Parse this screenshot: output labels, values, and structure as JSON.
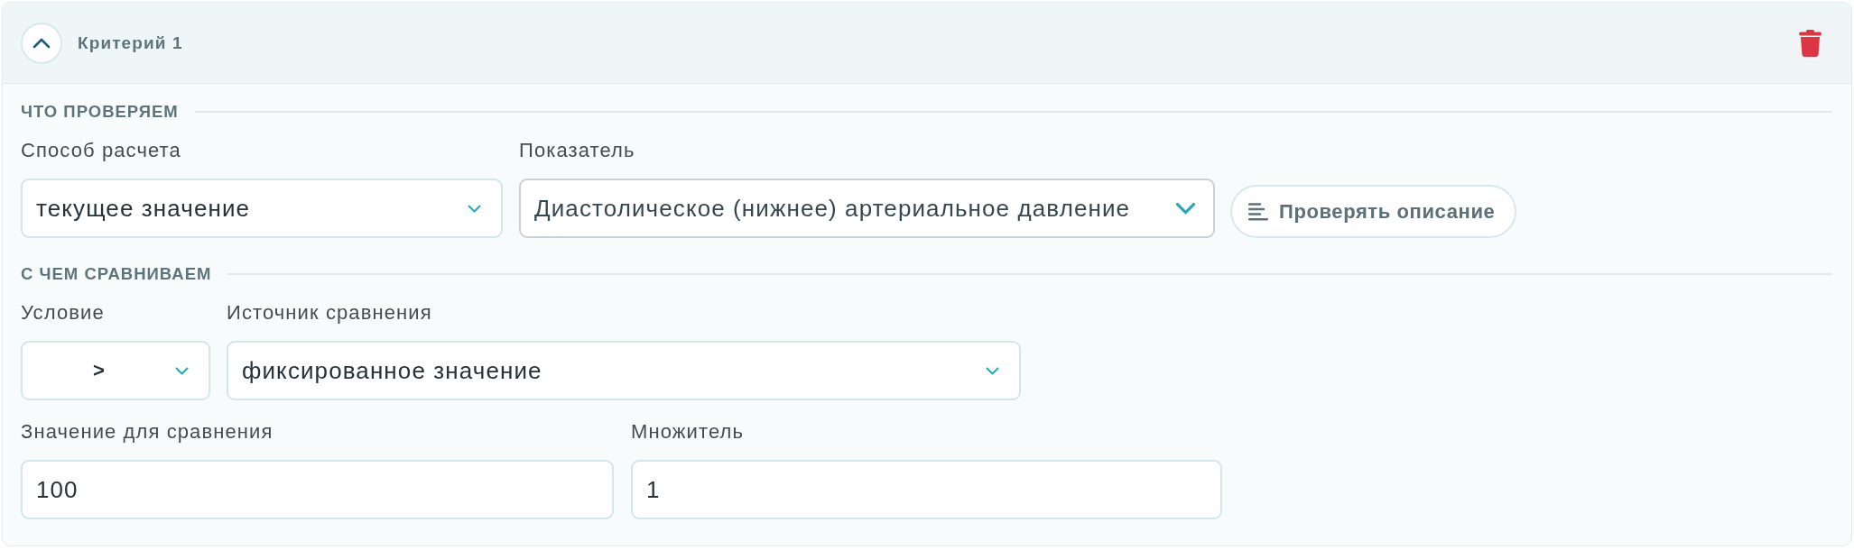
{
  "criterion": {
    "title": "Критерий 1",
    "expanded": true
  },
  "sections": [
    {
      "title": "ЧТО ПРОВЕРЯЕМ",
      "rows": [
        {
          "fields": [
            {
              "kind": "select",
              "label": "Способ расчета",
              "value": "текущее значение"
            },
            {
              "kind": "select",
              "label": "Показатель",
              "value": "Диастолическое (нижнее) артериальное давление"
            },
            {
              "kind": "button",
              "label": "Проверять описание"
            }
          ]
        }
      ]
    },
    {
      "title": "С ЧЕМ СРАВНИВАЕМ",
      "rows": [
        {
          "fields": [
            {
              "kind": "select",
              "label": "Условие",
              "value": ">"
            },
            {
              "kind": "select",
              "label": "Источник сравнения",
              "value": "фиксированное значение"
            }
          ]
        },
        {
          "fields": [
            {
              "kind": "input",
              "label": "Значение для сравнения",
              "value": "100"
            },
            {
              "kind": "input",
              "label": "Множитель",
              "value": "1"
            }
          ]
        }
      ]
    }
  ]
}
